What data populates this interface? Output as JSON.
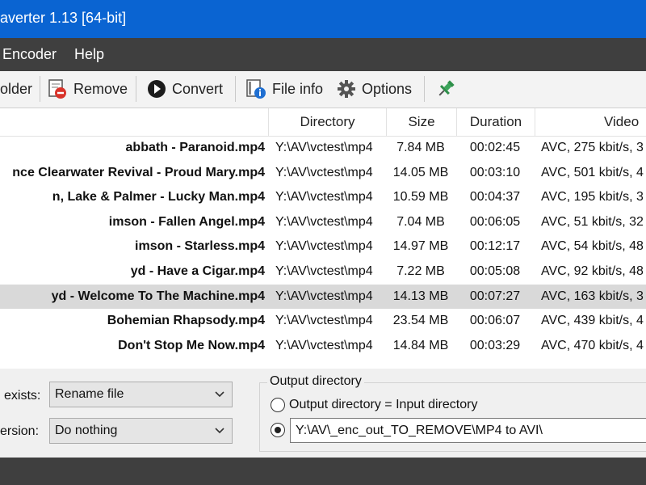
{
  "window": {
    "title": "averter 1.13  [64-bit]"
  },
  "menu": {
    "encoder": "Encoder",
    "help": "Help"
  },
  "toolbar": {
    "folder": "older",
    "remove": "Remove",
    "convert": "Convert",
    "file_info": "File info",
    "options": "Options"
  },
  "columns": {
    "directory": "Directory",
    "size": "Size",
    "duration": "Duration",
    "video": "Video"
  },
  "files": [
    {
      "name": "abbath - Paranoid.mp4",
      "dir": "Y:\\AV\\vctest\\mp4",
      "size": "7.84 MB",
      "duration": "00:02:45",
      "video": "AVC, 275 kbit/s, 3"
    },
    {
      "name": "nce Clearwater Revival - Proud Mary.mp4",
      "dir": "Y:\\AV\\vctest\\mp4",
      "size": "14.05 MB",
      "duration": "00:03:10",
      "video": "AVC, 501 kbit/s, 4"
    },
    {
      "name": "n, Lake & Palmer - Lucky Man.mp4",
      "dir": "Y:\\AV\\vctest\\mp4",
      "size": "10.59 MB",
      "duration": "00:04:37",
      "video": "AVC, 195 kbit/s, 3"
    },
    {
      "name": "imson - Fallen Angel.mp4",
      "dir": "Y:\\AV\\vctest\\mp4",
      "size": "7.04 MB",
      "duration": "00:06:05",
      "video": "AVC, 51 kbit/s, 32"
    },
    {
      "name": "imson - Starless.mp4",
      "dir": "Y:\\AV\\vctest\\mp4",
      "size": "14.97 MB",
      "duration": "00:12:17",
      "video": "AVC, 54 kbit/s, 48"
    },
    {
      "name": "yd - Have a Cigar.mp4",
      "dir": "Y:\\AV\\vctest\\mp4",
      "size": "7.22 MB",
      "duration": "00:05:08",
      "video": "AVC, 92 kbit/s, 48"
    },
    {
      "name": "yd - Welcome To The Machine.mp4",
      "dir": "Y:\\AV\\vctest\\mp4",
      "size": "14.13 MB",
      "duration": "00:07:27",
      "video": "AVC, 163 kbit/s, 3"
    },
    {
      "name": "Bohemian Rhapsody.mp4",
      "dir": "Y:\\AV\\vctest\\mp4",
      "size": "23.54 MB",
      "duration": "00:06:07",
      "video": "AVC, 439 kbit/s, 4"
    },
    {
      "name": "Don't Stop Me Now.mp4",
      "dir": "Y:\\AV\\vctest\\mp4",
      "size": "14.84 MB",
      "duration": "00:03:29",
      "video": "AVC, 470 kbit/s, 4"
    }
  ],
  "selected_index": 6,
  "options": {
    "exists_label": "exists:",
    "exists_value": "Rename file",
    "after_label": "ersion:",
    "after_value": "Do nothing"
  },
  "output": {
    "group_title": "Output directory",
    "same_as_input": "Output directory = Input directory",
    "path": "Y:\\AV\\_enc_out_TO_REMOVE\\MP4 to AVI\\"
  },
  "icons": [
    "folder-add-icon",
    "remove-icon",
    "convert-icon",
    "file-info-icon",
    "options-gear-icon",
    "pin-icon",
    "dropdown-arrow-icon"
  ],
  "colors": {
    "titlebar": "#0a64d2",
    "menubar": "#3f3f3f",
    "selected_row": "#d9d9d9",
    "pin": "#3aa55a"
  }
}
